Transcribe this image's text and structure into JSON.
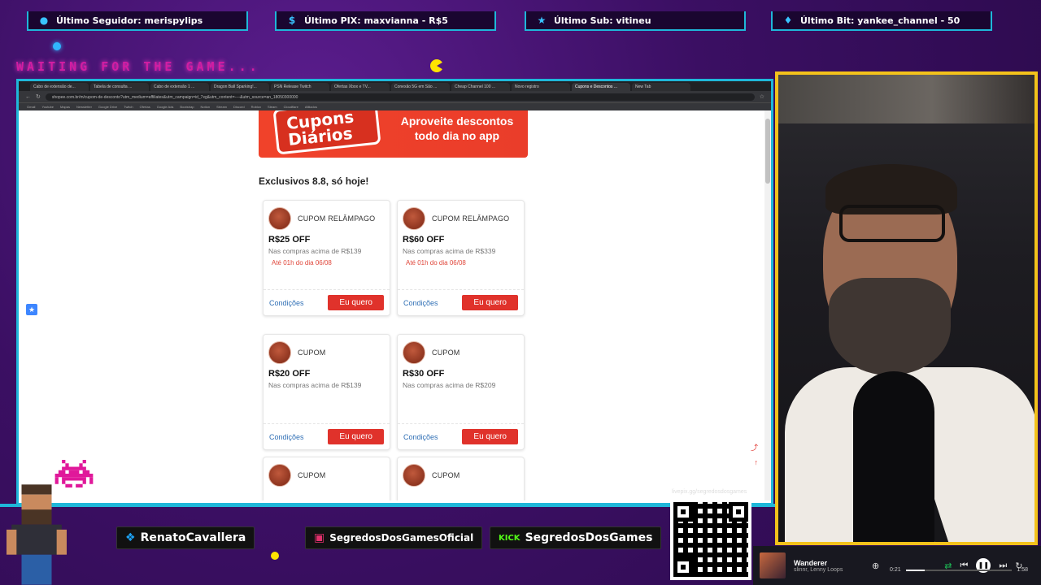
{
  "alerts": [
    {
      "icon": "person-icon",
      "text": "Último Seguidor: merispylips"
    },
    {
      "icon": "dollar-icon",
      "text": "Último PIX: maxvianna - R$5"
    },
    {
      "icon": "star-icon",
      "text": "Último Sub: vitineu"
    },
    {
      "icon": "diamond-icon",
      "text": "Último Bit: yankee_channel - 50"
    }
  ],
  "waiting_text": "WAITING FOR THE GAME...",
  "browser": {
    "tabs": [
      "Cabo de extensão de...",
      "Tabela de consulta ...",
      "Cabo de extensão 1 ...",
      "Dragon Ball Sparking!...",
      "PSN Release Twitch",
      "Ofertas Xbox e TV...",
      "Conexão 5G em São ...",
      "Cheap Channel 100 ...",
      "Novo registro",
      "Cupons e Descontos ...",
      "New Tab"
    ],
    "active_tab": 9,
    "url": "shopee.com.br/m/cupom-de-desconto?utm_medium=affiliates&utm_campaign=id_7xg&utm_content=----&utm_source=an_18050300000",
    "bookmarks": [
      "Gmail",
      "Youtube",
      "Mapas",
      "Newsletter",
      "Google Drive",
      "Twitch",
      "Ofertas",
      "Google Ads",
      "Bootstrap",
      "Notion",
      "Stream",
      "Discord",
      "Roblox",
      "Steam",
      "Cloudflare",
      "Afiliados"
    ]
  },
  "page": {
    "banner_badge": "Cupons Diários",
    "banner_tagline_1": "Aproveite descontos",
    "banner_tagline_2": "todo dia no app",
    "section_title": "Exclusivos 8.8, só hoje!",
    "coupons": [
      {
        "kind": "CUPOM RELÂMPAGO",
        "amount": "R$25 OFF",
        "condition": "Nas compras acima de R$139",
        "deadline": "Até 01h do dia 06/08",
        "link": "Condições",
        "button": "Eu quero"
      },
      {
        "kind": "CUPOM RELÂMPAGO",
        "amount": "R$60 OFF",
        "condition": "Nas compras acima de R$339",
        "deadline": "Até 01h do dia 06/08",
        "link": "Condições",
        "button": "Eu quero"
      },
      {
        "kind": "CUPOM",
        "amount": "R$20 OFF",
        "condition": "Nas compras acima de R$139",
        "deadline": "",
        "link": "Condições",
        "button": "Eu quero"
      },
      {
        "kind": "CUPOM",
        "amount": "R$30 OFF",
        "condition": "Nas compras acima de R$209",
        "deadline": "",
        "link": "Condições",
        "button": "Eu quero"
      },
      {
        "kind": "CUPOM",
        "amount": "",
        "condition": "",
        "deadline": "",
        "link": "",
        "button": ""
      },
      {
        "kind": "CUPOM",
        "amount": "",
        "condition": "",
        "deadline": "",
        "link": "",
        "button": ""
      }
    ]
  },
  "social": {
    "twitter": "RenatoCavallera",
    "instagram": "SegredosDosGamesOficial",
    "kick_label": "KICK",
    "kick": "SegredosDosGames"
  },
  "qr_label": "livepix.gg/segredosdosgames",
  "player": {
    "song": "Wanderer",
    "artist": "slinnr, Lenny Loops",
    "elapsed": "0:21",
    "duration": "1:58",
    "progress": 0.18
  },
  "colors": {
    "accent_cyan": "#1fb7d9",
    "cam_border": "#f3c21b",
    "shopee_red": "#e0322b",
    "neon_pink": "#d21da2"
  }
}
